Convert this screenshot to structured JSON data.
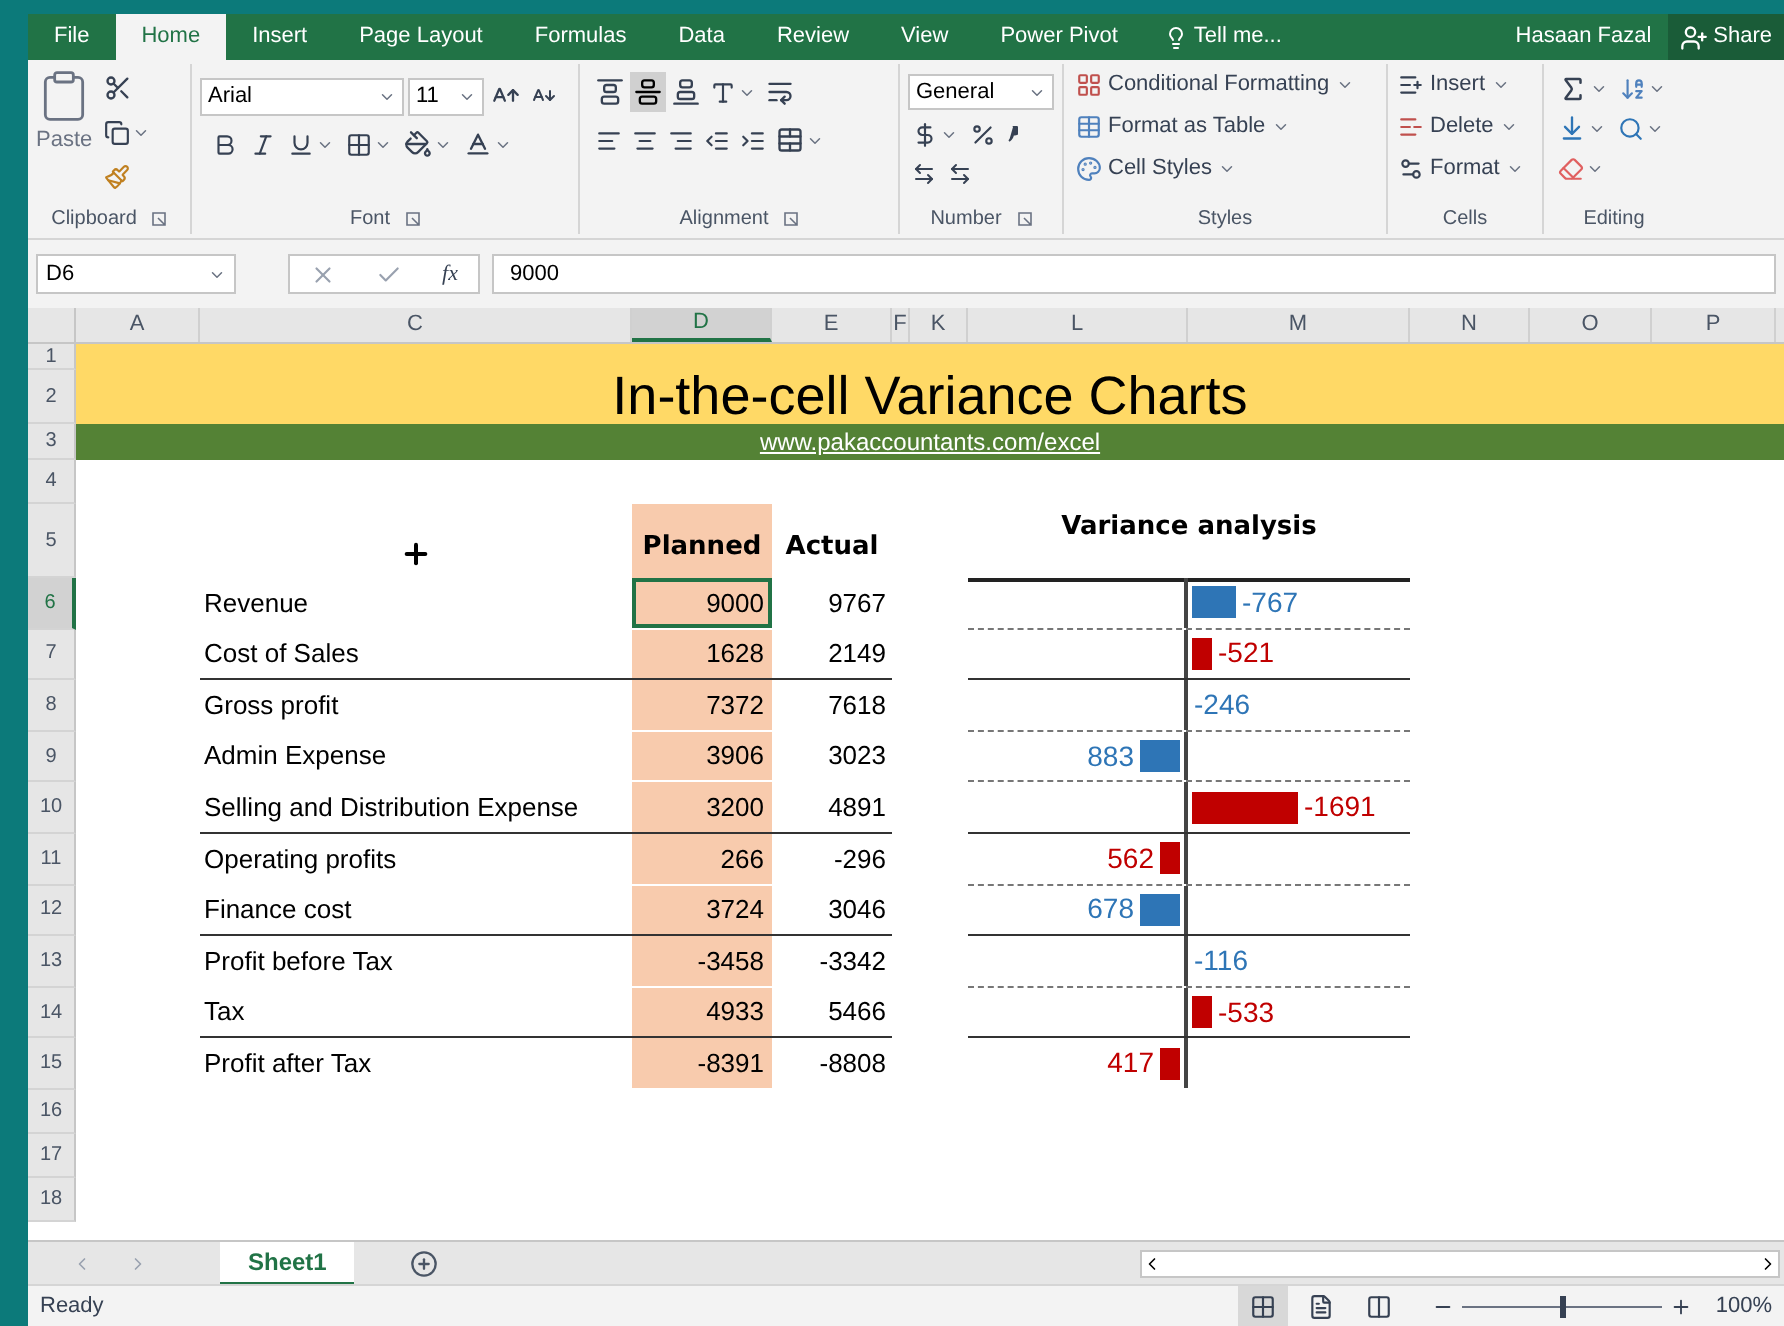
{
  "menu_tabs": [
    {
      "label": "File",
      "selected": false
    },
    {
      "label": "Home",
      "selected": true
    },
    {
      "label": "Insert",
      "selected": false
    },
    {
      "label": "Page Layout",
      "selected": false
    },
    {
      "label": "Formulas",
      "selected": false
    },
    {
      "label": "Data",
      "selected": false
    },
    {
      "label": "Review",
      "selected": false
    },
    {
      "label": "View",
      "selected": false
    },
    {
      "label": "Power Pivot",
      "selected": false
    }
  ],
  "tell_me": "Tell me...",
  "user": "Hasaan Fazal",
  "share": "Share",
  "ribbon": {
    "clipboard": {
      "paste": "Paste",
      "group": "Clipboard"
    },
    "font": {
      "name": "Arial",
      "size": "11",
      "group": "Font"
    },
    "alignment": {
      "group": "Alignment"
    },
    "number": {
      "format": "General",
      "group": "Number"
    },
    "styles": {
      "items": [
        "Conditional Formatting",
        "Format as Table",
        "Cell Styles"
      ],
      "group": "Styles"
    },
    "cells": {
      "items": [
        "Insert",
        "Delete",
        "Format"
      ],
      "group": "Cells"
    },
    "editing": {
      "group": "Editing"
    }
  },
  "formula_bar": {
    "name_box": "D6",
    "function_label": "fx",
    "value": "9000"
  },
  "columns": [
    {
      "label": "A",
      "selected": false
    },
    {
      "label": "C",
      "selected": false
    },
    {
      "label": "D",
      "selected": true
    },
    {
      "label": "E",
      "selected": false
    },
    {
      "label": "F",
      "selected": false
    },
    {
      "label": "K",
      "selected": false
    },
    {
      "label": "L",
      "selected": false
    },
    {
      "label": "M",
      "selected": false
    },
    {
      "label": "N",
      "selected": false
    },
    {
      "label": "O",
      "selected": false
    },
    {
      "label": "P",
      "selected": false
    }
  ],
  "row_numbers": [
    {
      "label": "1",
      "selected": false
    },
    {
      "label": "2",
      "selected": false
    },
    {
      "label": "3",
      "selected": false
    },
    {
      "label": "4",
      "selected": false
    },
    {
      "label": "5",
      "selected": false
    },
    {
      "label": "6",
      "selected": true
    },
    {
      "label": "7",
      "selected": false
    },
    {
      "label": "8",
      "selected": false
    },
    {
      "label": "9",
      "selected": false
    },
    {
      "label": "10",
      "selected": false
    },
    {
      "label": "11",
      "selected": false
    },
    {
      "label": "12",
      "selected": false
    },
    {
      "label": "13",
      "selected": false
    },
    {
      "label": "14",
      "selected": false
    },
    {
      "label": "15",
      "selected": false
    },
    {
      "label": "16",
      "selected": false
    },
    {
      "label": "17",
      "selected": false
    },
    {
      "label": "18",
      "selected": false
    }
  ],
  "sheet": {
    "title": "In-the-cell Variance Charts",
    "link": "www.pakaccountants.com/excel",
    "headers": {
      "planned": "Planned",
      "actual": "Actual",
      "variance": "Variance analysis"
    },
    "lines": [
      {
        "item": "Revenue",
        "planned": "9000",
        "actual": "9767",
        "selected": true,
        "kind": "item",
        "variance": {
          "value": "-767",
          "positive": false,
          "level": 0.2,
          "color": "#2e75b6"
        }
      },
      {
        "item": "Cost of Sales",
        "planned": "1628",
        "actual": "2149",
        "selected": false,
        "kind": "subtotal",
        "variance": {
          "value": "-521",
          "positive": false,
          "level": 0.09,
          "color": "#c00000"
        }
      },
      {
        "item": "Gross profit",
        "planned": "7372",
        "actual": "7618",
        "selected": false,
        "kind": "item",
        "variance": {
          "value": "-246",
          "positive": false,
          "color": "#2e75b6"
        }
      },
      {
        "item": "Admin Expense",
        "planned": "3906",
        "actual": "3023",
        "selected": false,
        "kind": "item",
        "variance": {
          "value": "883",
          "positive": true,
          "level": 0.18,
          "color": "#2e75b6"
        }
      },
      {
        "item": "Selling and Distribution Expense",
        "planned": "3200",
        "actual": "4891",
        "selected": false,
        "kind": "subtotal",
        "variance": {
          "value": "-1691",
          "positive": false,
          "level": 0.48,
          "color": "#c00000"
        }
      },
      {
        "item": "Operating profits",
        "planned": "266",
        "actual": "-296",
        "selected": false,
        "kind": "item",
        "variance": {
          "value": "562",
          "positive": true,
          "level": 0.09,
          "color": "#c00000"
        }
      },
      {
        "item": "Finance cost",
        "planned": "3724",
        "actual": "3046",
        "selected": false,
        "kind": "subtotal",
        "variance": {
          "value": "678",
          "positive": true,
          "level": 0.18,
          "color": "#2e75b6"
        }
      },
      {
        "item": "Profit before Tax",
        "planned": "-3458",
        "actual": "-3342",
        "selected": false,
        "kind": "item",
        "variance": {
          "value": "-116",
          "positive": false,
          "color": "#2e75b6"
        }
      },
      {
        "item": "Tax",
        "planned": "4933",
        "actual": "5466",
        "selected": false,
        "kind": "subtotal",
        "variance": {
          "value": "-533",
          "positive": false,
          "level": 0.09,
          "color": "#c00000"
        }
      },
      {
        "item": "Profit after Tax",
        "planned": "-8391",
        "actual": "-8808",
        "selected": false,
        "kind": "total",
        "variance": {
          "value": "417",
          "positive": true,
          "level": 0.09,
          "color": "#c00000"
        }
      }
    ]
  },
  "sheet_tabs": [
    {
      "label": "Sheet1",
      "selected": true
    }
  ],
  "status": "Ready",
  "zoom": {
    "level": 0.5,
    "reading": "100%"
  }
}
